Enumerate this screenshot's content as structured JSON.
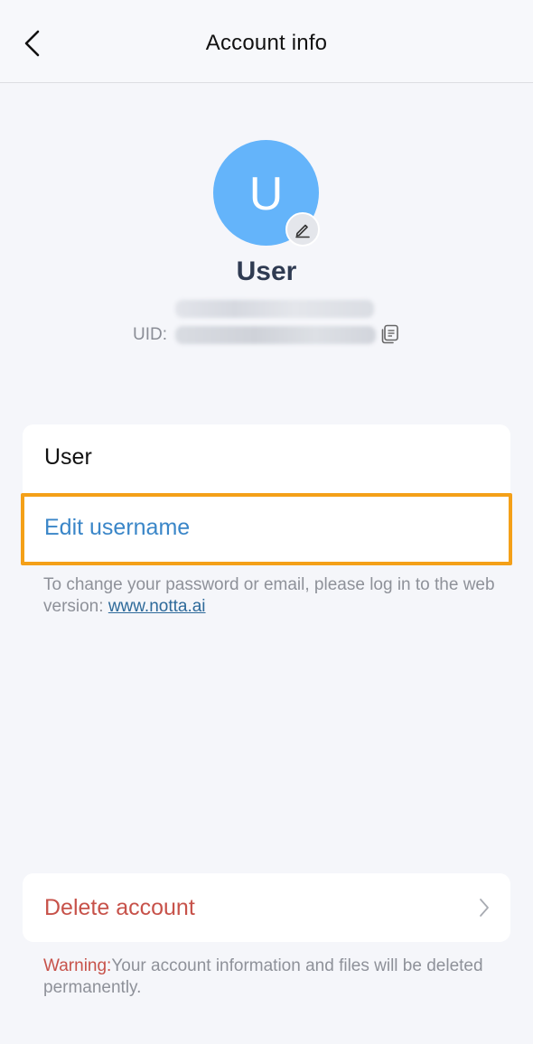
{
  "header": {
    "title": "Account info",
    "back_icon": "chevron-left-icon"
  },
  "profile": {
    "avatar_initial": "U",
    "avatar_color": "#64b4fa",
    "edit_avatar_icon": "pencil-icon",
    "name": "User",
    "uid_label": "UID:",
    "copy_icon": "copy-icon"
  },
  "username_card": {
    "current_name": "User",
    "edit_label": "Edit username",
    "highlight_color": "#f4a018"
  },
  "note": {
    "text": "To change your password or email, please log in to the web version: ",
    "link": "www.notta.ai"
  },
  "delete_card": {
    "label": "Delete account",
    "chevron_icon": "chevron-right-icon"
  },
  "warning": {
    "prefix": "Warning:",
    "text": "Your account information and files will be deleted permanently."
  }
}
